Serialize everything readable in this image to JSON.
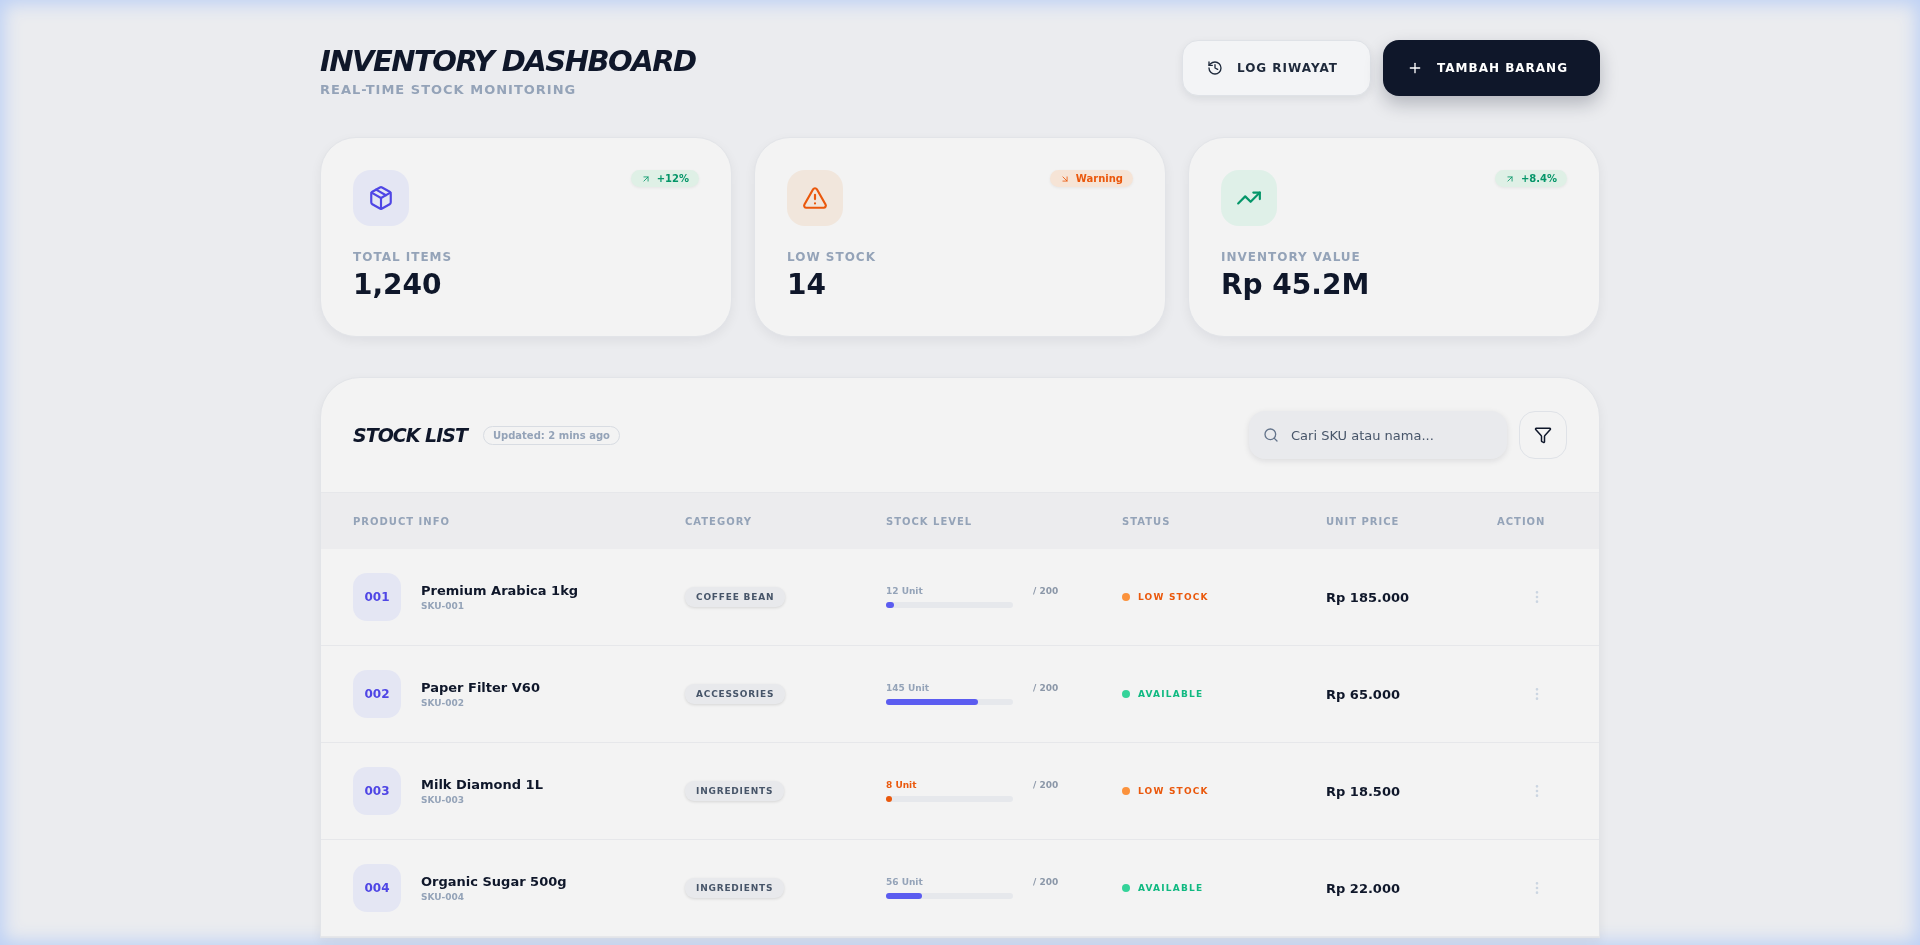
{
  "header": {
    "title": "INVENTORY DASHBOARD",
    "subtitle": "REAL-TIME STOCK MONITORING",
    "buttons": [
      {
        "kind": "history",
        "label": "LOG RIWAYAT"
      },
      {
        "kind": "add",
        "label": "TAMBAH BARANG"
      }
    ]
  },
  "stats": [
    {
      "kind": "box",
      "badge": {
        "kind": "up",
        "label": "+12%"
      },
      "label": "TOTAL ITEMS",
      "value": "1,240"
    },
    {
      "kind": "warning",
      "badge": {
        "kind": "down",
        "label": "Warning"
      },
      "label": "LOW STOCK",
      "value": "14"
    },
    {
      "kind": "trend",
      "badge": {
        "kind": "up",
        "label": "+8.4%"
      },
      "label": "INVENTORY VALUE",
      "value": "Rp 45.2M"
    }
  ],
  "stock_list": {
    "title": "STOCK LIST",
    "updated": "Updated: 2 mins ago",
    "search": {
      "placeholder": "Cari SKU atau nama..."
    },
    "columns": [
      "PRODUCT INFO",
      "CATEGORY",
      "STOCK LEVEL",
      "STATUS",
      "UNIT PRICE",
      "ACTION"
    ],
    "rows": [
      {
        "code": "001",
        "name": "Premium Arabica 1kg",
        "sku": "SKU-001",
        "category": "COFFEE BEAN",
        "stock": "12 Unit",
        "max": "/ 200",
        "level": 0.06,
        "critical": false,
        "status": {
          "kind": "low",
          "label": "LOW STOCK"
        },
        "price": "Rp 185.000"
      },
      {
        "code": "002",
        "name": "Paper Filter V60",
        "sku": "SKU-002",
        "category": "ACCESSORIES",
        "stock": "145 Unit",
        "max": "/ 200",
        "level": 0.725,
        "critical": false,
        "status": {
          "kind": "available",
          "label": "AVAILABLE"
        },
        "price": "Rp 65.000"
      },
      {
        "code": "003",
        "name": "Milk Diamond 1L",
        "sku": "SKU-003",
        "category": "INGREDIENTS",
        "stock": "8 Unit",
        "max": "/ 200",
        "level": 0.04,
        "critical": true,
        "status": {
          "kind": "low",
          "label": "LOW STOCK"
        },
        "price": "Rp 18.500"
      },
      {
        "code": "004",
        "name": "Organic Sugar 500g",
        "sku": "SKU-004",
        "category": "INGREDIENTS",
        "stock": "56 Unit",
        "max": "/ 200",
        "level": 0.28,
        "critical": false,
        "status": {
          "kind": "available",
          "label": "AVAILABLE"
        },
        "price": "Rp 22.000"
      }
    ]
  }
}
